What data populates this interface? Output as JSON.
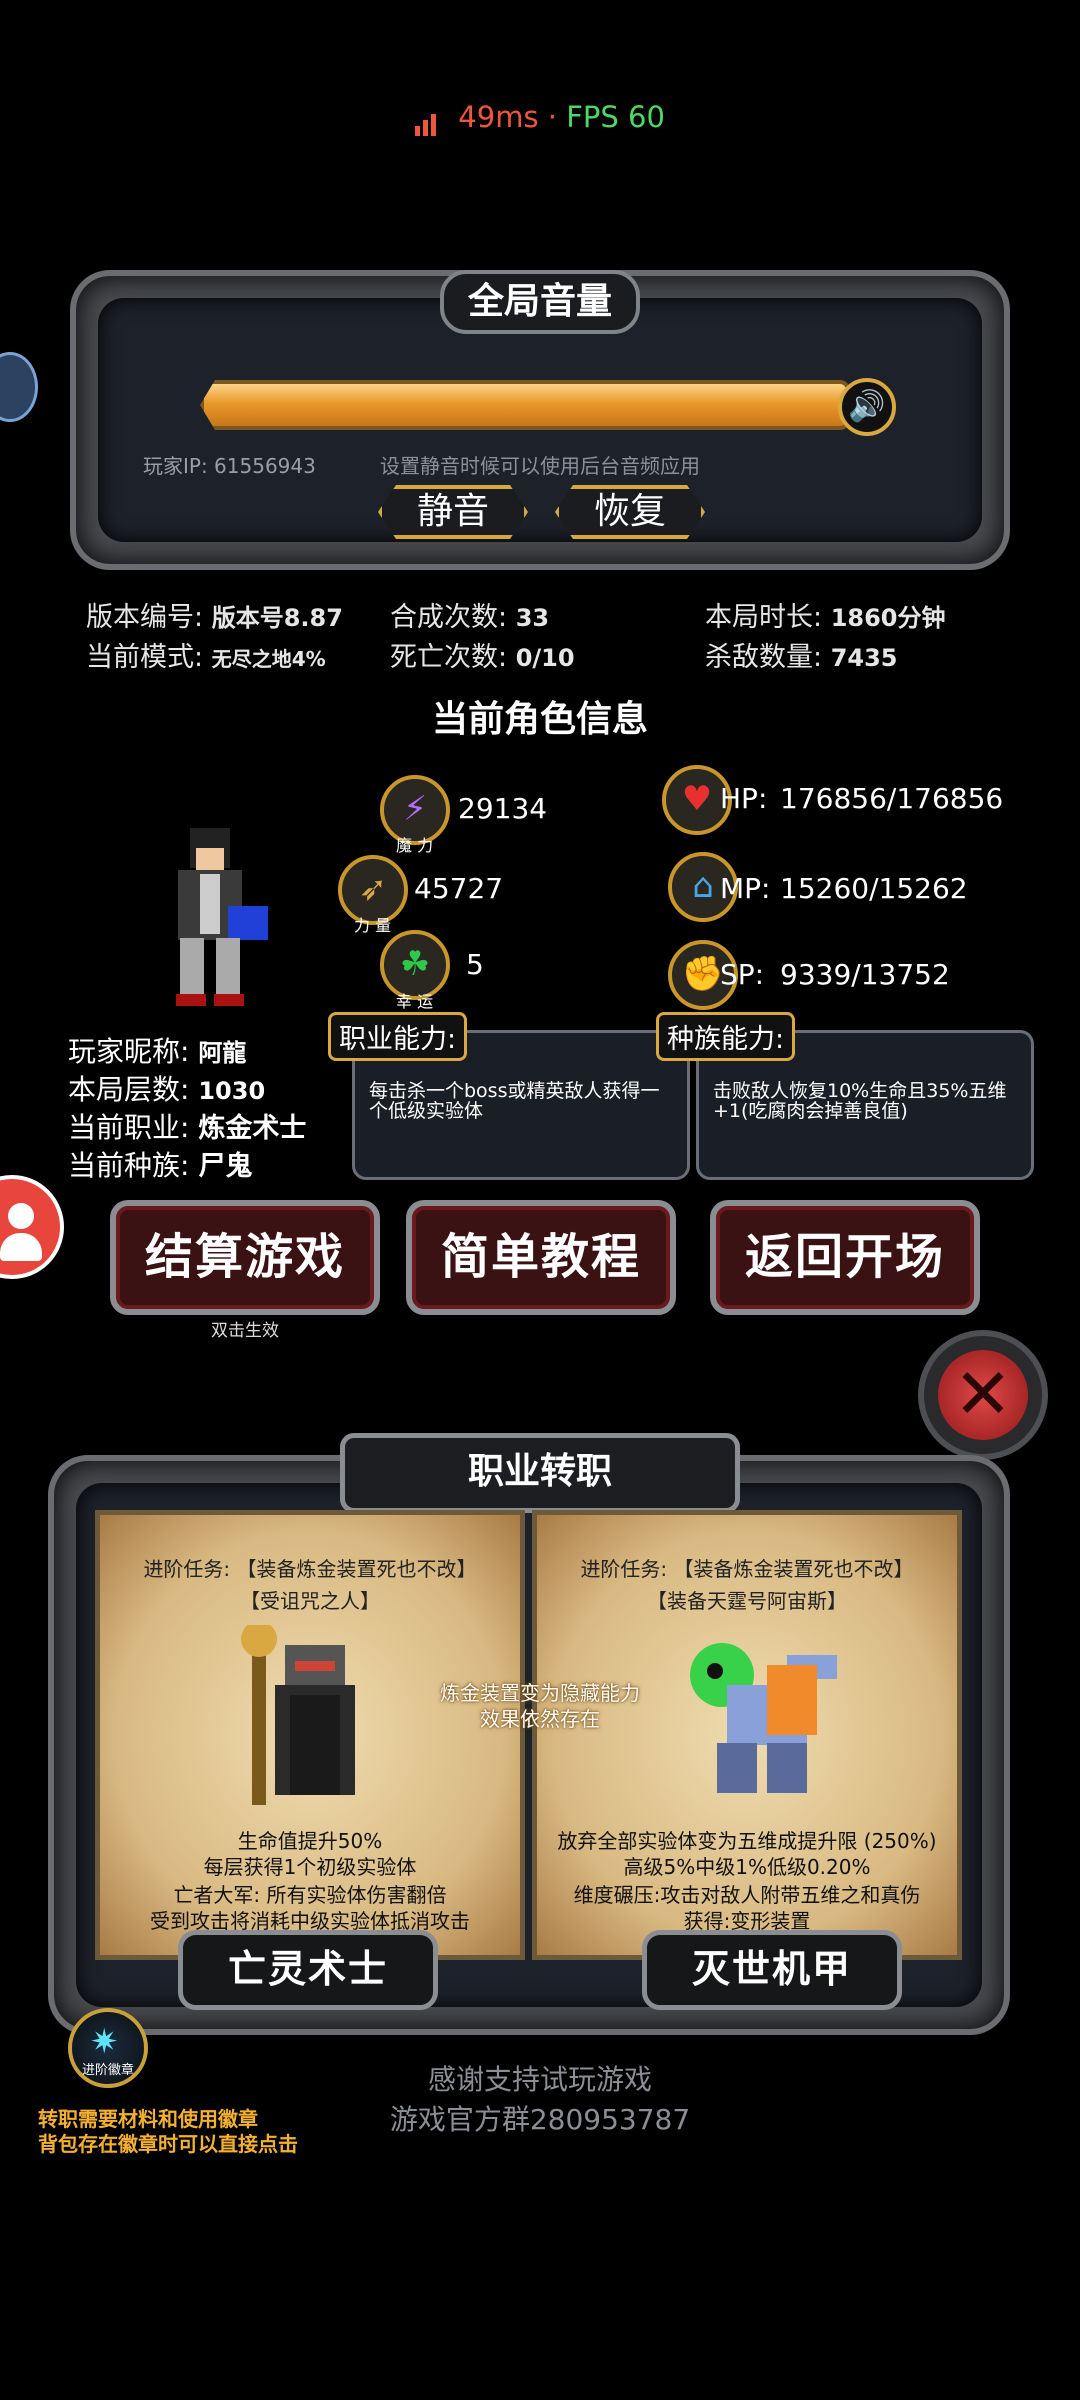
{
  "status_bar": {
    "latency": "49ms",
    "separator": "·",
    "fps": "FPS 60"
  },
  "volume": {
    "title": "全局音量",
    "level": 0.95,
    "player_ip": "玩家IP: 61556943",
    "tip": "设置静音时候可以使用后台音频应用",
    "mute_label": "静音",
    "restore_label": "恢复"
  },
  "game_info": {
    "version_label": "版本编号:",
    "version_value": "版本号8.87",
    "mode_label": "当前模式:",
    "mode_value": "无尽之地4%",
    "synth_label": "合成次数:",
    "synth_value": "33",
    "death_label": "死亡次数:",
    "death_value": "0/10",
    "duration_label": "本局时长:",
    "duration_value": "1860分钟",
    "kills_label": "杀敌数量:",
    "kills_value": "7435"
  },
  "character": {
    "section_title": "当前角色信息",
    "magic": {
      "value": "29134",
      "caption": "魔 力"
    },
    "strength": {
      "value": "45727",
      "caption": "力 量"
    },
    "luck": {
      "value": "5",
      "caption": "幸 运"
    },
    "hp": {
      "label": "HP:",
      "value": "176856/176856"
    },
    "mp": {
      "label": "MP:",
      "value": "15260/15262"
    },
    "sp": {
      "label": "SP:",
      "value": "9339/13752"
    },
    "nickname_label": "玩家昵称:",
    "nickname": "阿龍",
    "floor_label": "本局层数:",
    "floor": "1030",
    "job_label": "当前职业:",
    "job": "炼金术士",
    "race_label": "当前种族:",
    "race": "尸鬼",
    "job_ability_title": "职业能力:",
    "job_ability_text": "每击杀一个boss或精英敌人获得一个低级实验体",
    "race_ability_title": "种族能力:",
    "race_ability_text": "击败敌人恢复10%生命且35%五维+1(吃腐肉会掉善良值)"
  },
  "actions": {
    "settle": "结算游戏",
    "settle_sub": "双击生效",
    "tutorial": "简单教程",
    "back": "返回开场"
  },
  "job_change": {
    "title": "职业转职",
    "mid_note_1": "炼金装置变为隐藏能力",
    "mid_note_2": "效果依然存在",
    "left": {
      "quest_line_1": "进阶任务: 【装备炼金装置死也不改】",
      "quest_line_2": "【受诅咒之人】",
      "desc_1": "生命值提升50%",
      "desc_2": "每层获得1个初级实验体",
      "desc_3": "亡者大军: 所有实验体伤害翻倍",
      "desc_4": "受到攻击将消耗中级实验体抵消攻击",
      "button": "亡灵术士"
    },
    "right": {
      "quest_line_1": "进阶任务: 【装备炼金装置死也不改】",
      "quest_line_2": "【装备天霆号阿宙斯】",
      "desc_1": "放弃全部实验体变为五维成提升限 (250%)",
      "desc_2": "高级5%中级1%低级0.20%",
      "desc_3": "维度碾压:攻击对敌人附带五维之和真伤",
      "desc_4": "获得:变形装置",
      "button": "灭世机甲"
    }
  },
  "footer": {
    "badge_label": "进阶徽章",
    "note_1": "转职需要材料和使用徽章",
    "note_2": "背包存在徽章时可以直接点击",
    "thanks": "感谢支持试玩游戏",
    "group": "游戏官方群280953787"
  },
  "colors": {
    "accent_gold": "#d9a840",
    "panel_bg": "#1d2129",
    "button_red": "#3a1214",
    "latency": "#f0553d",
    "fps": "#4cd964"
  }
}
